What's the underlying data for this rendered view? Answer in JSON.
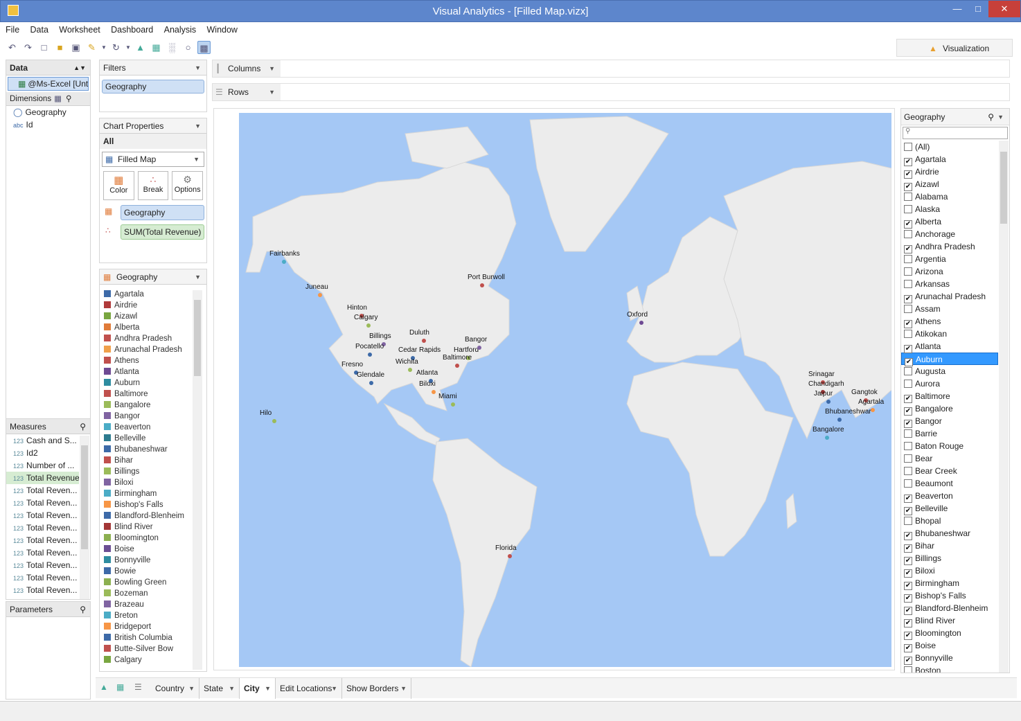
{
  "window": {
    "title": "Visual Analytics - [Filled Map.vizx]"
  },
  "menu": [
    "File",
    "Data",
    "Worksheet",
    "Dashboard",
    "Analysis",
    "Window"
  ],
  "visualization_tab": "Visualization",
  "data_panel": {
    "title": "Data",
    "source": "@Ms-Excel [Unt...",
    "dimensions_title": "Dimensions",
    "dimensions": [
      "Geography",
      "Id"
    ]
  },
  "measures_panel": {
    "title": "Measures",
    "items": [
      "Cash and S...",
      "Id2",
      "Number of ...",
      "Total Revenue",
      "Total Reven...",
      "Total Reven...",
      "Total Reven...",
      "Total Reven...",
      "Total Reven...",
      "Total Reven...",
      "Total Reven...",
      "Total Reven...",
      "Total Reven..."
    ],
    "selected": "Total Revenue"
  },
  "parameters_panel": {
    "title": "Parameters"
  },
  "filters": {
    "title": "Filters",
    "items": [
      "Geography"
    ]
  },
  "chart_properties": {
    "title": "Chart Properties",
    "scope": "All",
    "chart_type": "Filled Map",
    "buttons": [
      "Color",
      "Break",
      "Options"
    ],
    "color_field": "Geography",
    "size_field": "SUM(Total Revenue)"
  },
  "legend": {
    "title": "Geography",
    "items": [
      {
        "name": "Agartala",
        "color": "#3d6aa8"
      },
      {
        "name": "Airdrie",
        "color": "#b03a3a"
      },
      {
        "name": "Aizawl",
        "color": "#79a640"
      },
      {
        "name": "Alberta",
        "color": "#e07b39"
      },
      {
        "name": "Andhra Pradesh",
        "color": "#c0504d"
      },
      {
        "name": "Arunachal Pradesh",
        "color": "#f0a04b"
      },
      {
        "name": "Athens",
        "color": "#c0504d"
      },
      {
        "name": "Atlanta",
        "color": "#6e4a93"
      },
      {
        "name": "Auburn",
        "color": "#2e8ca0"
      },
      {
        "name": "Baltimore",
        "color": "#c0504d"
      },
      {
        "name": "Bangalore",
        "color": "#9bbb59"
      },
      {
        "name": "Bangor",
        "color": "#8064a2"
      },
      {
        "name": "Beaverton",
        "color": "#4bacc6"
      },
      {
        "name": "Belleville",
        "color": "#2d7b8f"
      },
      {
        "name": "Bhubaneshwar",
        "color": "#3d6aa8"
      },
      {
        "name": "Bihar",
        "color": "#c0504d"
      },
      {
        "name": "Billings",
        "color": "#9bbb59"
      },
      {
        "name": "Biloxi",
        "color": "#8064a2"
      },
      {
        "name": "Birmingham",
        "color": "#4bacc6"
      },
      {
        "name": "Bishop's Falls",
        "color": "#f79646"
      },
      {
        "name": "Blandford-Blenheim",
        "color": "#3d6aa8"
      },
      {
        "name": "Blind River",
        "color": "#a33636"
      },
      {
        "name": "Bloomington",
        "color": "#8cb050"
      },
      {
        "name": "Boise",
        "color": "#6b4e94"
      },
      {
        "name": "Bonnyville",
        "color": "#2e8ca0"
      },
      {
        "name": "Bowie",
        "color": "#3d6aa8"
      },
      {
        "name": "Bowling Green",
        "color": "#8cb050"
      },
      {
        "name": "Bozeman",
        "color": "#9bbb59"
      },
      {
        "name": "Brazeau",
        "color": "#8064a2"
      },
      {
        "name": "Breton",
        "color": "#4bacc6"
      },
      {
        "name": "Bridgeport",
        "color": "#f79646"
      },
      {
        "name": "British Columbia",
        "color": "#3d6aa8"
      },
      {
        "name": "Butte-Silver Bow",
        "color": "#c0504d"
      },
      {
        "name": "Calgary",
        "color": "#79a640"
      }
    ]
  },
  "shelves": {
    "columns": "Columns",
    "rows": "Rows"
  },
  "geo_filter": {
    "title": "Geography",
    "search_placeholder": "",
    "items": [
      {
        "name": "(All)",
        "checked": false
      },
      {
        "name": "Agartala",
        "checked": true
      },
      {
        "name": "Airdrie",
        "checked": true
      },
      {
        "name": "Aizawl",
        "checked": true
      },
      {
        "name": "Alabama",
        "checked": false
      },
      {
        "name": "Alaska",
        "checked": false
      },
      {
        "name": "Alberta",
        "checked": true
      },
      {
        "name": "Anchorage",
        "checked": false
      },
      {
        "name": "Andhra Pradesh",
        "checked": true
      },
      {
        "name": "Argentia",
        "checked": false
      },
      {
        "name": "Arizona",
        "checked": false
      },
      {
        "name": "Arkansas",
        "checked": false
      },
      {
        "name": "Arunachal Pradesh",
        "checked": true
      },
      {
        "name": "Assam",
        "checked": false
      },
      {
        "name": "Athens",
        "checked": true
      },
      {
        "name": "Atikokan",
        "checked": false
      },
      {
        "name": "Atlanta",
        "checked": true
      },
      {
        "name": "Auburn",
        "checked": true,
        "selected": true
      },
      {
        "name": "Augusta",
        "checked": false
      },
      {
        "name": "Aurora",
        "checked": false
      },
      {
        "name": "Baltimore",
        "checked": true
      },
      {
        "name": "Bangalore",
        "checked": true
      },
      {
        "name": "Bangor",
        "checked": true
      },
      {
        "name": "Barrie",
        "checked": false
      },
      {
        "name": "Baton Rouge",
        "checked": false
      },
      {
        "name": "Bear",
        "checked": false
      },
      {
        "name": "Bear Creek",
        "checked": false
      },
      {
        "name": "Beaumont",
        "checked": false
      },
      {
        "name": "Beaverton",
        "checked": true
      },
      {
        "name": "Belleville",
        "checked": true
      },
      {
        "name": "Bhopal",
        "checked": false
      },
      {
        "name": "Bhubaneshwar",
        "checked": true
      },
      {
        "name": "Bihar",
        "checked": true
      },
      {
        "name": "Billings",
        "checked": true
      },
      {
        "name": "Biloxi",
        "checked": true
      },
      {
        "name": "Birmingham",
        "checked": true
      },
      {
        "name": "Bishop's Falls",
        "checked": true
      },
      {
        "name": "Blandford-Blenheim",
        "checked": true
      },
      {
        "name": "Blind River",
        "checked": true
      },
      {
        "name": "Bloomington",
        "checked": true
      },
      {
        "name": "Boise",
        "checked": true
      },
      {
        "name": "Bonnyville",
        "checked": true
      },
      {
        "name": "Boston",
        "checked": false
      }
    ]
  },
  "map_labels": [
    "Fairbanks",
    "Juneau",
    "Hinton",
    "Calgary",
    "Billings",
    "Pocatello",
    "Duluth",
    "Cedar Rapids",
    "Hartford",
    "Bangor",
    "Port Burwoll",
    "Baltimore",
    "Fresno",
    "Glendale",
    "Wichita",
    "Atlanta",
    "Biloxi",
    "Miami",
    "Hilo",
    "Florida",
    "Oxford",
    "Srinagar",
    "Chandigarh",
    "Jaipur",
    "Gangtok",
    "Agartala",
    "Bhubaneshwar",
    "Bangalore"
  ],
  "bottom_tabs": [
    "Country",
    "State",
    "City",
    "Edit Locations",
    "Show Borders"
  ],
  "active_tab": "City"
}
